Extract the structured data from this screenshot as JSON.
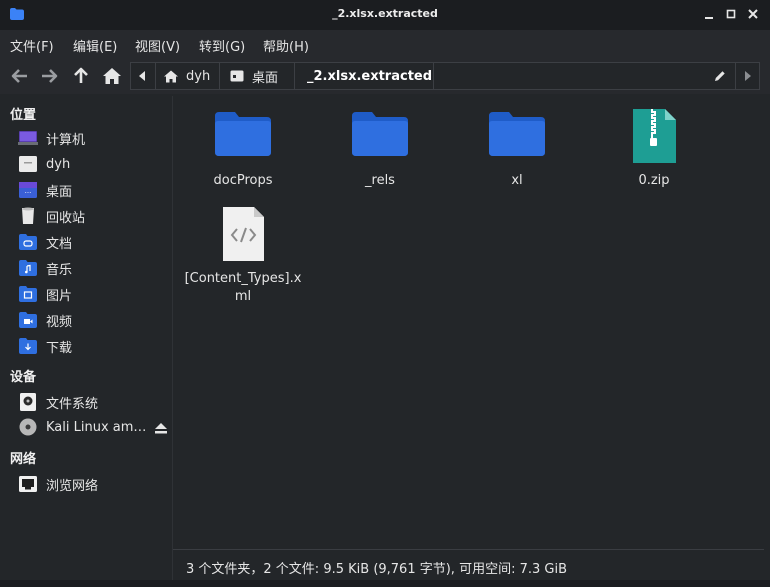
{
  "window": {
    "title": "_2.xlsx.extracted"
  },
  "menu": [
    "文件(F)",
    "编辑(E)",
    "视图(V)",
    "转到(G)",
    "帮助(H)"
  ],
  "breadcrumbs": [
    {
      "label": "dyh",
      "icon": "home-icon"
    },
    {
      "label": "桌面",
      "icon": "desktop-icon"
    },
    {
      "label": "_2.xlsx.extracted",
      "icon": ""
    }
  ],
  "sidebar": {
    "places_header": "位置",
    "places": [
      {
        "label": "计算机",
        "icon": "computer-icon"
      },
      {
        "label": "dyh",
        "icon": "home-folder-icon"
      },
      {
        "label": "桌面",
        "icon": "desktop-folder-icon"
      },
      {
        "label": "回收站",
        "icon": "trash-icon"
      },
      {
        "label": "文档",
        "icon": "documents-folder-icon"
      },
      {
        "label": "音乐",
        "icon": "music-folder-icon"
      },
      {
        "label": "图片",
        "icon": "pictures-folder-icon"
      },
      {
        "label": "视频",
        "icon": "videos-folder-icon"
      },
      {
        "label": "下载",
        "icon": "downloads-folder-icon"
      }
    ],
    "devices_header": "设备",
    "devices": [
      {
        "label": "文件系统",
        "icon": "drive-icon"
      },
      {
        "label": "Kali Linux am…",
        "icon": "optical-disc-icon"
      }
    ],
    "network_header": "网络",
    "network": [
      {
        "label": "浏览网络",
        "icon": "network-icon"
      }
    ]
  },
  "files": [
    {
      "name": "docProps",
      "type": "folder"
    },
    {
      "name": "_rels",
      "type": "folder"
    },
    {
      "name": "xl",
      "type": "folder"
    },
    {
      "name": "0.zip",
      "type": "zip"
    },
    {
      "name": "[Content_Types].xml",
      "type": "xml"
    }
  ],
  "status": "3 个文件夹，2 个文件: 9.5 KiB (9,761 字节), 可用空间: 7.3 GiB",
  "colors": {
    "folder": "#2f6fe0",
    "zip": "#1e9e94",
    "background": "#232629"
  }
}
